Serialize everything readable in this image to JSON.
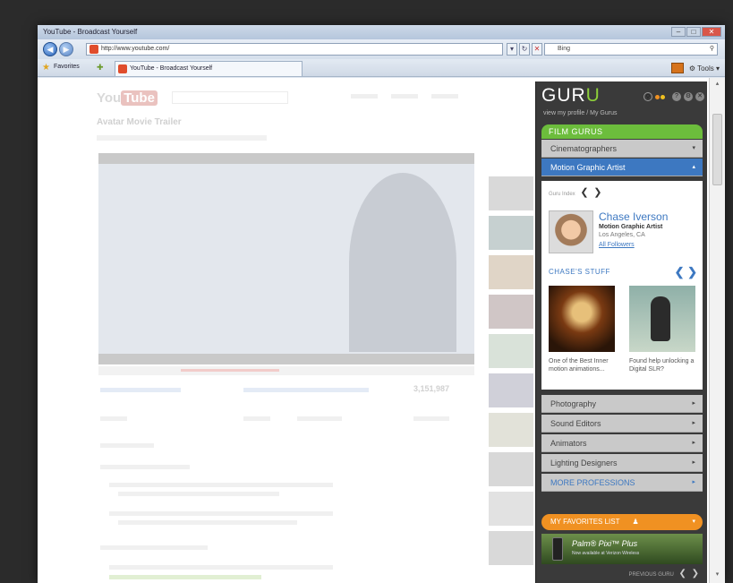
{
  "browser": {
    "title": "YouTube - Broadcast Yourself",
    "address": "http://www.youtube.com/",
    "search_placeholder": "Bing",
    "favorites_label": "Favorites",
    "tab_label": "YouTube - Broadcast Yourself",
    "tools_label": "Tools"
  },
  "youtube": {
    "logo_you": "You",
    "logo_tube": "Tube",
    "video_title": "Avatar Movie Trailer",
    "views": "3,151,987"
  },
  "guru": {
    "logo_main": "GUR",
    "logo_accent": "U",
    "subtitle": "view my profile / My Gurus",
    "film_header": "FILM GURUS",
    "professions_top": [
      {
        "label": "Cinematographers",
        "chev": "▾",
        "active": false
      },
      {
        "label": "Motion Graphic Artist",
        "chev": "▴",
        "active": true
      }
    ],
    "pager_text": "Guru Index",
    "pager_prev": "❮",
    "pager_next": "❯",
    "profile": {
      "name": "Chase Iverson",
      "role": "Motion Graphic Artist",
      "location": "Los Angeles, CA",
      "followers": "All Followers"
    },
    "stuff_header": "CHASE'S STUFF",
    "stuff_nav": "❮ ❯",
    "stuff_items": [
      {
        "caption": "One of the Best Inner motion animations..."
      },
      {
        "caption": "Found help unlocking a Digital SLR?"
      }
    ],
    "professions_bottom": [
      {
        "label": "Photography",
        "chev": "▸"
      },
      {
        "label": "Sound Editors",
        "chev": "▸"
      },
      {
        "label": "Animators",
        "chev": "▸"
      },
      {
        "label": "Lighting Designers",
        "chev": "▸"
      },
      {
        "label": "MORE PROFESSIONS",
        "chev": "▸"
      }
    ],
    "favorites_header": "MY FAVORITES LIST",
    "favorites_chev": "▾",
    "ad_title": "Palm® Pixi™ Plus",
    "ad_sub": "Now available at Verizon Wireless",
    "footer_text": "PREVIOUS GURU",
    "footer_prev": "❮",
    "footer_next": "❯"
  },
  "colors": {
    "guru_green": "#6cbd3c",
    "guru_blue": "#3d78c1",
    "guru_orange": "#f09122",
    "panel_bg": "#3a3a3a"
  }
}
